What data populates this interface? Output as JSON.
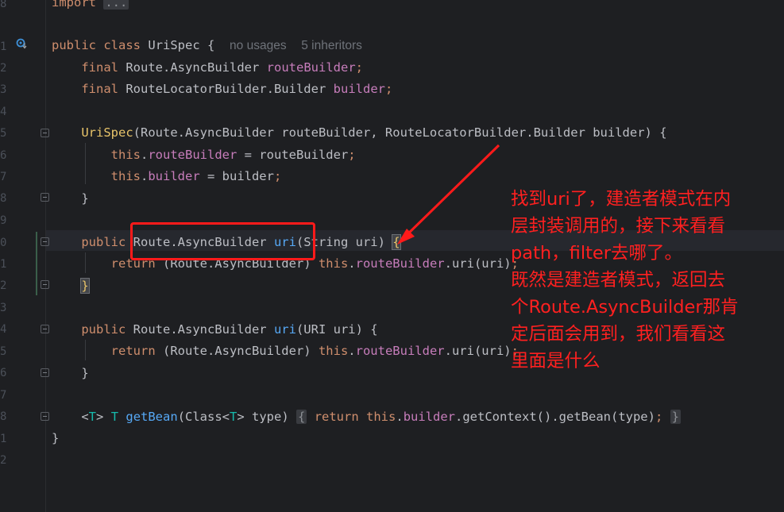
{
  "gutter": {
    "line_numbers": [
      "8",
      "",
      "1",
      "2",
      "3",
      "",
      "5",
      "6",
      "7",
      "8",
      "9",
      "0",
      "1",
      "2",
      "3",
      "4",
      "5",
      "6",
      "7",
      "8",
      "1",
      "2"
    ]
  },
  "code": {
    "line_import": {
      "kw": "import",
      "folded": "..."
    },
    "line_class": {
      "kw1": "public",
      "kw2": "class",
      "name": "UriSpec",
      "brace": "{",
      "hint_usages": "no usages",
      "hint_inheritors": "5 inheritors"
    },
    "line_f1": {
      "kw": "final",
      "type": "Route.AsyncBuilder",
      "field": "routeBuilder",
      "semi": ";"
    },
    "line_f2": {
      "kw": "final",
      "type": "RouteLocatorBuilder.Builder",
      "field": "builder",
      "semi": ";"
    },
    "line_ctor": {
      "name": "UriSpec",
      "params": "(Route.AsyncBuilder routeBuilder, RouteLocatorBuilder.Builder builder) {"
    },
    "line_a1": {
      "kw": "this",
      "dot": ".",
      "field": "routeBuilder",
      "rest": " = routeBuilder",
      "semi": ";"
    },
    "line_a2": {
      "kw": "this",
      "dot": ".",
      "field": "builder",
      "rest": " = builder",
      "semi": ";"
    },
    "line_close1": "}",
    "line_m1": {
      "kw": "public",
      "type": " Route.AsyncBuilder ",
      "name": "uri",
      "params": "(String uri) ",
      "brace": "{"
    },
    "line_m1_ret": {
      "kw": "return",
      "cast": " (Route.AsyncBuilder) ",
      "this": "this",
      "dot": ".",
      "field": "routeBuilder",
      "call": ".uri(uri)",
      "semi": ";"
    },
    "line_m1_close": "}",
    "line_m2": {
      "kw": "public",
      "type": " Route.AsyncBuilder ",
      "name": "uri",
      "params": "(URI uri) {"
    },
    "line_m2_ret": {
      "kw": "return",
      "cast": " (Route.AsyncBuilder) ",
      "this": "this",
      "dot": ".",
      "field": "routeBuilder",
      "call": ".uri(uri)",
      "semi": ";"
    },
    "line_m2_close": "}",
    "line_gb": {
      "lt": "<",
      "tp": "T",
      "gt": ">",
      "tp2": " T ",
      "name": "getBean",
      "params": "(Class<",
      "tp3": "T",
      "params2": "> type) ",
      "ob": "{",
      "ret": " return ",
      "this": "this",
      "dot": ".",
      "field": "builder",
      "call": ".getContext().getBean(type)",
      "semi": ";",
      "cb": "}"
    },
    "line_class_close": "}"
  },
  "annotation": {
    "lines": [
      "找到uri了，建造者模式在内",
      "层封装调用的，接下来看看",
      "path，filter去哪了。",
      "既然是建造者模式，返回去",
      "个Route.AsyncBuilder那肯",
      "定后面会用到，我们看看这",
      "里面是什么"
    ],
    "color": "#ff2020"
  },
  "colors": {
    "background": "#1e1f22",
    "keyword": "#cf8e6d",
    "field": "#c77dbb",
    "method": "#56a8f5",
    "annotation_red": "#ff1a1a"
  }
}
